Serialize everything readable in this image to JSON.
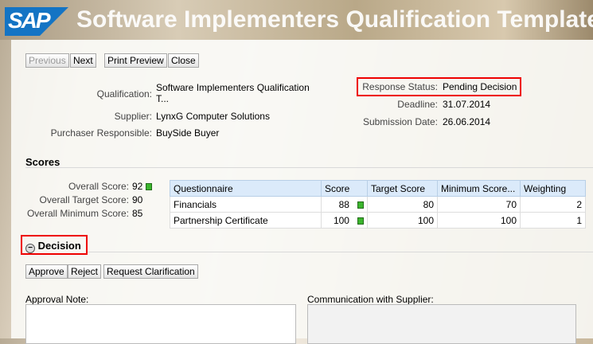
{
  "header": {
    "logo": "SAP",
    "title": "Software Implementers Qualification Template"
  },
  "toolbar": {
    "previous": "Previous",
    "next": "Next",
    "print_preview": "Print Preview",
    "close": "Close"
  },
  "info": {
    "qualification_label": "Qualification:",
    "qualification_value": "Software Implementers Qualification T...",
    "supplier_label": "Supplier:",
    "supplier_value": "LynxG Computer Solutions",
    "purchaser_label": "Purchaser Responsible:",
    "purchaser_value": "BuySide Buyer",
    "status_label": "Response Status:",
    "status_value": "Pending Decision",
    "deadline_label": "Deadline:",
    "deadline_value": "31.07.2014",
    "submission_label": "Submission Date:",
    "submission_value": "26.06.2014"
  },
  "scores": {
    "title": "Scores",
    "overall_label": "Overall Score:",
    "overall_value": "92",
    "target_label": "Overall Target Score:",
    "target_value": "90",
    "minimum_label": "Overall Minimum Score:",
    "minimum_value": "85",
    "columns": [
      "Questionnaire",
      "Score",
      "Target Score",
      "Minimum Score...",
      "Weighting"
    ],
    "rows": [
      {
        "questionnaire": "Financials",
        "score": "88",
        "target": "80",
        "minimum": "70",
        "weighting": "2"
      },
      {
        "questionnaire": "Partnership Certificate",
        "score": "100",
        "target": "100",
        "minimum": "100",
        "weighting": "1"
      }
    ]
  },
  "decision": {
    "title": "Decision",
    "approve": "Approve",
    "reject": "Reject",
    "request_clarification": "Request Clarification",
    "approval_note_label": "Approval Note:",
    "communication_label": "Communication with Supplier:"
  }
}
